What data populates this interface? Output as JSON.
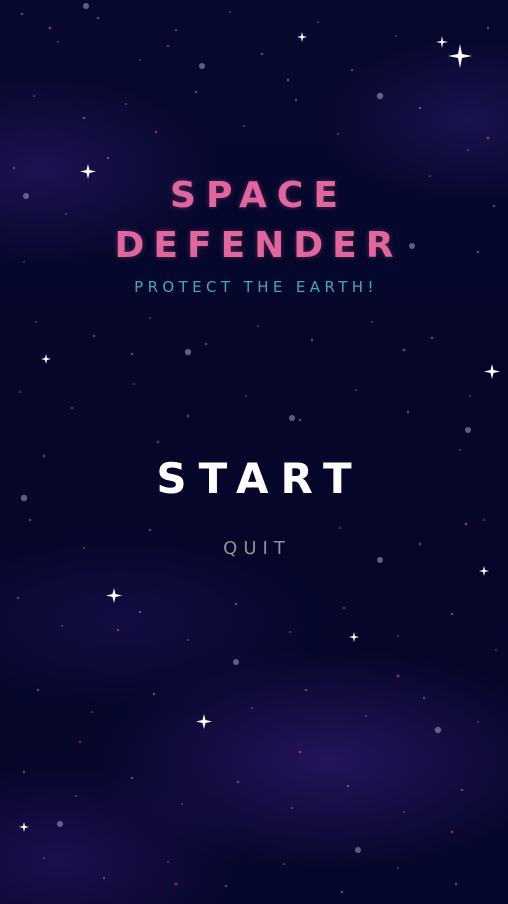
{
  "game": {
    "title_line1": "SPACE",
    "title_line2": "DEFENDER",
    "subtitle": "PROTECT THE EARTH!"
  },
  "menu": {
    "start_label": "START",
    "quit_label": "QUIT"
  },
  "colors": {
    "title": "#e0669e",
    "subtitle": "#4aa6b0",
    "start": "#ffffff",
    "quit": "#8f9199",
    "background": "#05062a"
  }
}
